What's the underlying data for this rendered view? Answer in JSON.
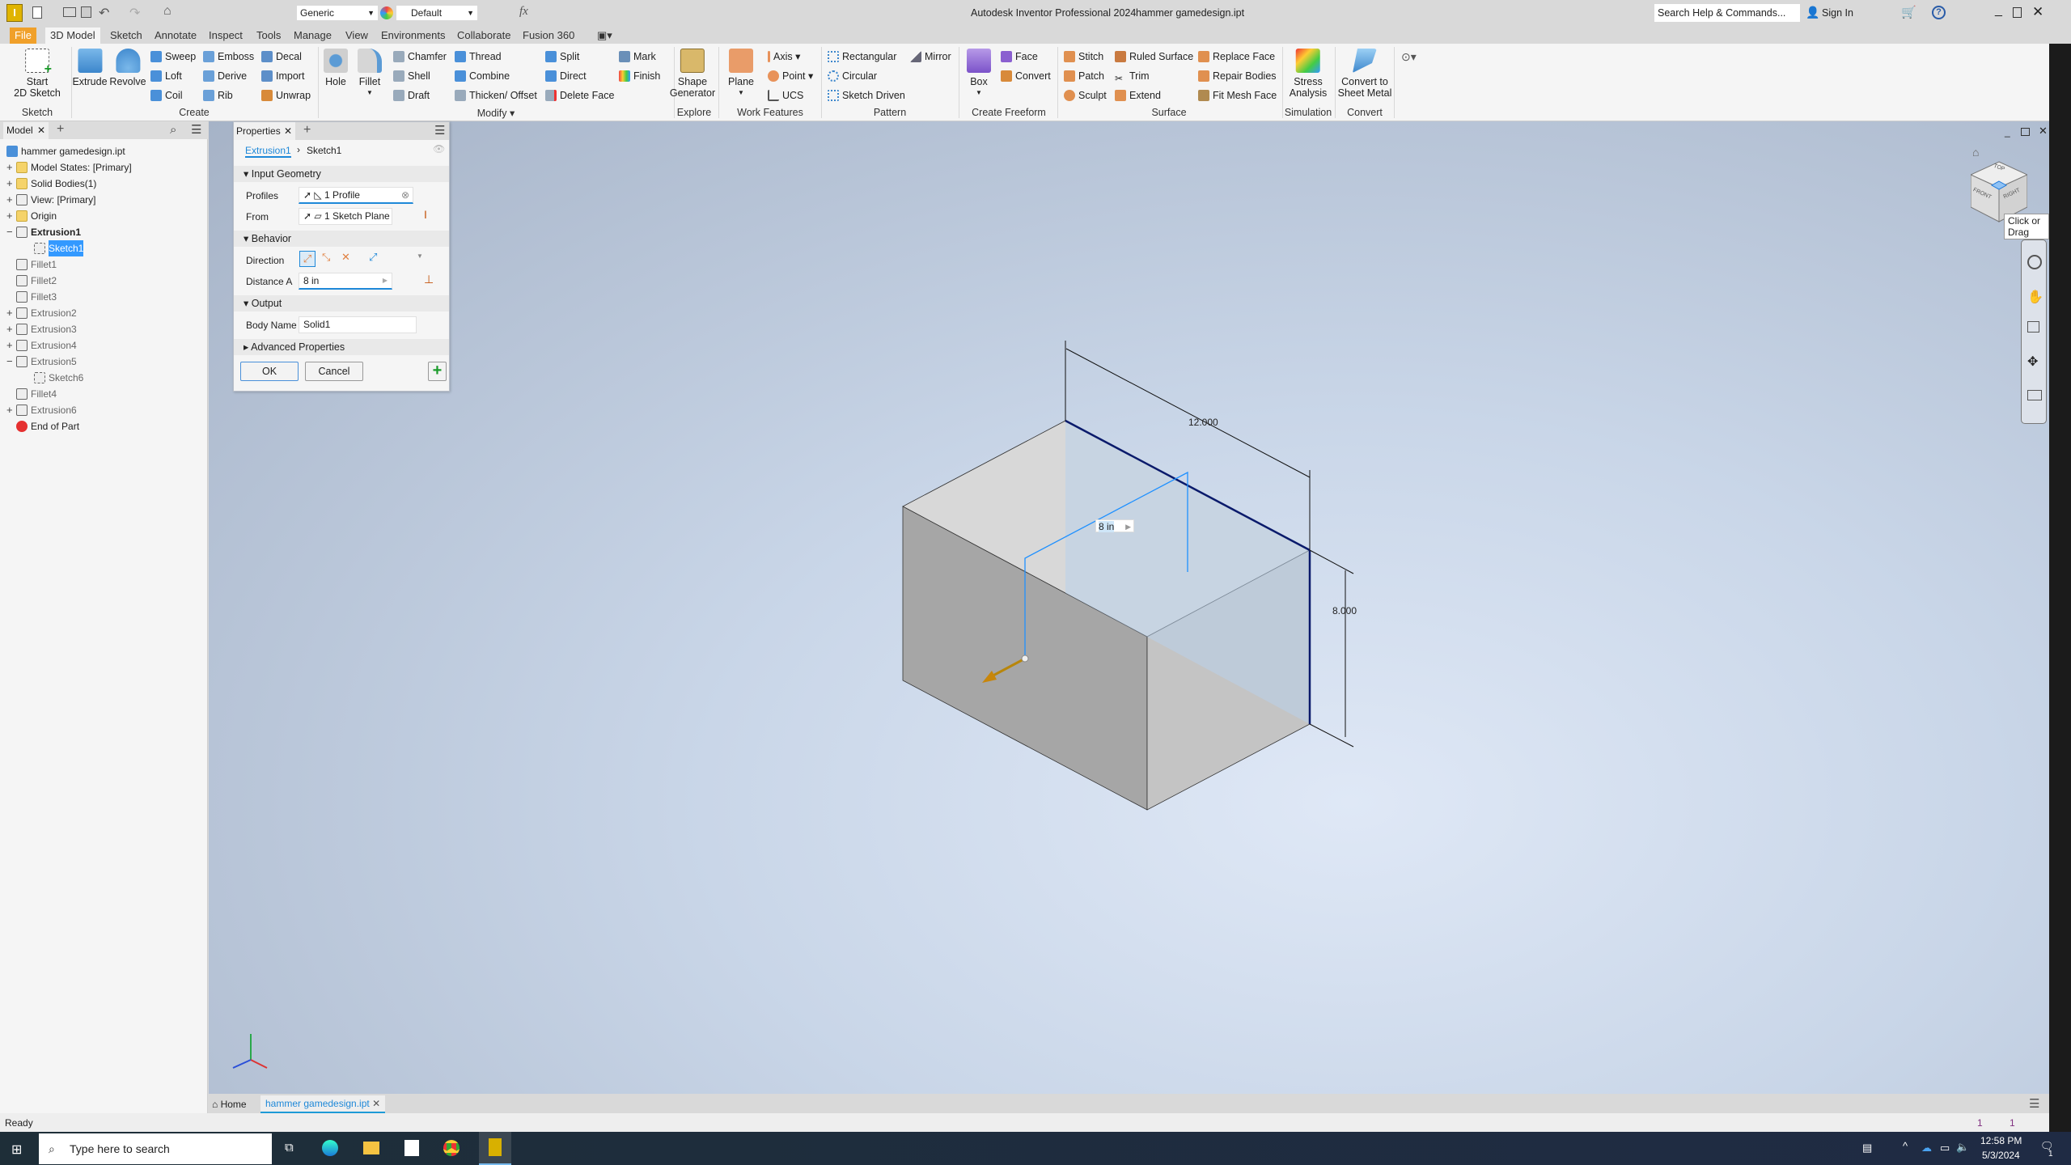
{
  "title_bar": {
    "app_title": "Autodesk Inventor Professional 2024",
    "file_name": "hammer gamedesign.ipt",
    "material": "Generic",
    "appearance": "Default",
    "search_placeholder": "Search Help & Commands...",
    "sign_in": "Sign In"
  },
  "tabs": [
    "File",
    "3D Model",
    "Sketch",
    "Annotate",
    "Inspect",
    "Tools",
    "Manage",
    "View",
    "Environments",
    "Collaborate",
    "Fusion 360"
  ],
  "active_tab": "3D Model",
  "ribbon": {
    "sketch": {
      "label": "Sketch",
      "start_line1": "Start",
      "start_line2": "2D Sketch"
    },
    "create": {
      "label": "Create",
      "extrude": "Extrude",
      "revolve": "Revolve",
      "sweep": "Sweep",
      "loft": "Loft",
      "coil": "Coil",
      "emboss": "Emboss",
      "derive": "Derive",
      "rib": "Rib",
      "decal": "Decal",
      "import": "Import",
      "unwrap": "Unwrap"
    },
    "modify": {
      "label": "Modify",
      "hole": "Hole",
      "fillet": "Fillet",
      "chamfer": "Chamfer",
      "shell": "Shell",
      "draft": "Draft",
      "thread": "Thread",
      "combine": "Combine",
      "thicken": "Thicken/ Offset",
      "split": "Split",
      "direct": "Direct",
      "delete_face": "Delete Face",
      "mark": "Mark",
      "finish": "Finish"
    },
    "explore": {
      "label": "Explore",
      "shape1": "Shape",
      "shape2": "Generator"
    },
    "work_features": {
      "label": "Work Features",
      "plane": "Plane",
      "axis": "Axis",
      "point": "Point",
      "ucs": "UCS"
    },
    "pattern": {
      "label": "Pattern",
      "rectangular": "Rectangular",
      "circular": "Circular",
      "sketch_driven": "Sketch Driven",
      "mirror": "Mirror"
    },
    "freeform": {
      "label": "Create Freeform",
      "box": "Box",
      "face": "Face",
      "convert": "Convert"
    },
    "surface": {
      "label": "Surface",
      "stitch": "Stitch",
      "patch": "Patch",
      "sculpt": "Sculpt",
      "ruled": "Ruled Surface",
      "trim": "Trim",
      "extend": "Extend",
      "replace": "Replace Face",
      "repair": "Repair Bodies",
      "fitmesh": "Fit Mesh Face"
    },
    "simulation": {
      "label": "Simulation",
      "l1": "Stress",
      "l2": "Analysis"
    },
    "convert": {
      "label": "Convert",
      "l1": "Convert to",
      "l2": "Sheet Metal"
    }
  },
  "browser": {
    "tab": "Model",
    "items": [
      {
        "label": "hammer gamedesign.ipt"
      },
      {
        "label": "Model States: [Primary]"
      },
      {
        "label": "Solid Bodies(1)"
      },
      {
        "label": "View: [Primary]"
      },
      {
        "label": "Origin"
      },
      {
        "label": "Extrusion1"
      },
      {
        "label": "Sketch1"
      },
      {
        "label": "Fillet1"
      },
      {
        "label": "Fillet2"
      },
      {
        "label": "Fillet3"
      },
      {
        "label": "Extrusion2"
      },
      {
        "label": "Extrusion3"
      },
      {
        "label": "Extrusion4"
      },
      {
        "label": "Extrusion5"
      },
      {
        "label": "Sketch6"
      },
      {
        "label": "Fillet4"
      },
      {
        "label": "Extrusion6"
      },
      {
        "label": "End of Part"
      }
    ]
  },
  "properties": {
    "tab": "Properties",
    "breadcrumb_parent": "Extrusion1",
    "breadcrumb_current": "Sketch1",
    "input_geometry": "Input Geometry",
    "profiles_label": "Profiles",
    "profiles_value": "1 Profile",
    "from_label": "From",
    "from_value": "1 Sketch Plane",
    "behavior": "Behavior",
    "direction_label": "Direction",
    "distance_label": "Distance A",
    "distance_value": "8 in",
    "output": "Output",
    "body_name_label": "Body Name",
    "body_name_value": "Solid1",
    "advanced": "Advanced Properties",
    "ok": "OK",
    "cancel": "Cancel"
  },
  "viewport": {
    "dim_length": "12.000",
    "dim_height": "8.000",
    "distance_input": "8 in",
    "tooltip": "Click or Drag",
    "viewcube": {
      "top": "TOP",
      "front": "FRONT",
      "right": "RIGHT"
    },
    "highlight_color": "#0a1a6b",
    "sketch_color": "#1e90ff"
  },
  "doc_tabs": {
    "home": "Home",
    "active": "hammer gamedesign.ipt"
  },
  "status": {
    "text": "Ready",
    "count1": "1",
    "count2": "1"
  },
  "taskbar": {
    "search_placeholder": "Type here to search",
    "time": "12:58 PM",
    "date": "5/3/2024",
    "notifications": "1"
  }
}
